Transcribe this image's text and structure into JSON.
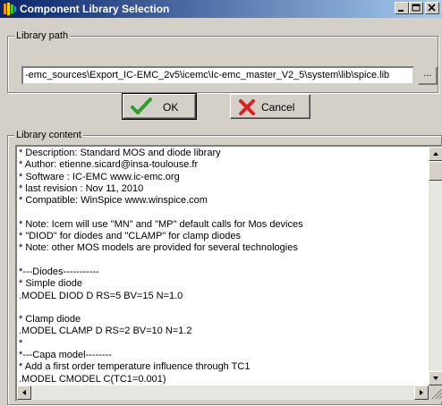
{
  "window": {
    "title": "Component Library Selection"
  },
  "library_path": {
    "legend": "Library path",
    "value": "-emc_sources\\Export_IC-EMC_2v5\\icemc\\Ic-emc_master_V2_5\\system\\lib\\spice.lib",
    "browse_label": "..."
  },
  "buttons": {
    "ok_label": "OK",
    "cancel_label": "Cancel"
  },
  "library_content": {
    "legend": "Library content",
    "lines": [
      "* Description: Standard MOS and diode library",
      "* Author: etienne.sicard@insa-toulouse.fr",
      "* Software : IC-EMC www.ic-emc.org",
      "* last revision : Nov 11, 2010",
      "* Compatible: WinSpice www.winspice.com",
      "",
      "* Note: Icem will use \"MN\" and \"MP\" default calls for Mos devices",
      "* \"DIOD\" for diodes and \"CLAMP\" for clamp diodes",
      "* Note: other MOS models are provided for several technologies",
      "",
      "*---Diodes-----------",
      "* Simple diode",
      ".MODEL DIOD D RS=5 BV=15 N=1.0",
      "",
      "* Clamp diode",
      ".MODEL CLAMP D RS=2 BV=10 N=1.2",
      "*",
      "*---Capa model--------",
      "* Add a first order temperature influence through TC1",
      ".MODEL CMODEL C(TC1=0.001)"
    ]
  }
}
